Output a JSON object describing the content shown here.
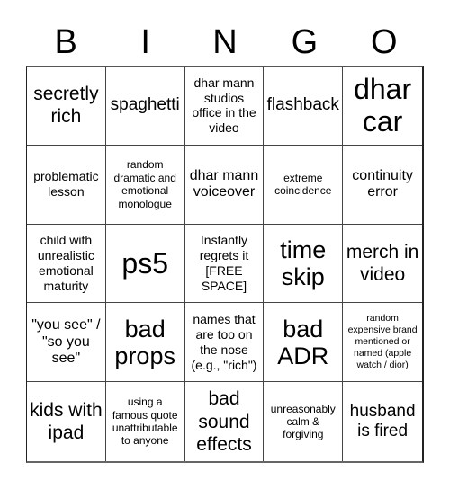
{
  "header": {
    "letters": [
      "B",
      "I",
      "N",
      "G",
      "O"
    ]
  },
  "board": {
    "cells": [
      [
        "secretly rich",
        "spaghetti",
        "dhar mann studios office in the video",
        "flashback",
        "dhar car"
      ],
      [
        "problematic lesson",
        "random dramatic and emotional monologue",
        "dhar mann voiceover",
        "extreme coincidence",
        "continuity error"
      ],
      [
        "child with unrealistic emotional maturity",
        "ps5",
        "Instantly regrets it [FREE SPACE]",
        "time skip",
        "merch in video"
      ],
      [
        "\"you see\" / \"so you see\"",
        "bad props",
        "names that are too on the nose (e.g., \"rich\")",
        "bad ADR",
        "random expensive brand mentioned or named (apple watch / dior)"
      ],
      [
        "kids with ipad",
        "using a famous quote unattributable to anyone",
        "bad sound effects",
        "unreasonably calm & forgiving",
        "husband is fired"
      ]
    ],
    "free_space": "Instantly regrets it [FREE SPACE]"
  }
}
